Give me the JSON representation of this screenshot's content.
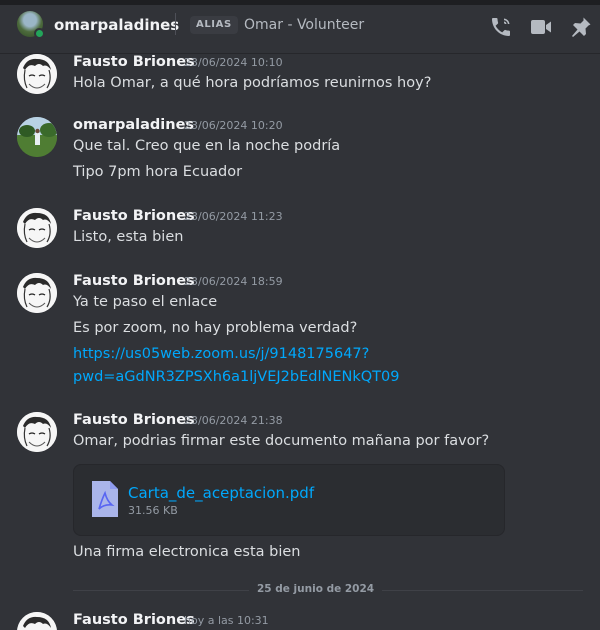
{
  "header": {
    "username": "omarpaladines",
    "alias_tag": "ALIAS",
    "alias_value": "Omar - Volunteer",
    "status_color": "#23a55a",
    "icons": [
      "voice-call-icon",
      "video-call-icon",
      "pin-icon"
    ]
  },
  "messages": [
    {
      "author": "Fausto Briones",
      "timestamp": "23/06/2024 10:10",
      "lines": [
        "Hola Omar, a qué hora podríamos reunirnos hoy?"
      ]
    },
    {
      "author": "omarpaladines",
      "timestamp": "23/06/2024 10:20",
      "lines": [
        "Que tal. Creo que en la noche podría",
        "Tipo 7pm hora Ecuador"
      ]
    },
    {
      "author": "Fausto Briones",
      "timestamp": "23/06/2024 11:23",
      "lines": [
        "Listo, esta bien"
      ]
    },
    {
      "author": "Fausto Briones",
      "timestamp": "23/06/2024 18:59",
      "lines": [
        "Ya te paso el enlace",
        "Es por zoom, no hay problema verdad?"
      ],
      "link_lines": [
        "https://us05web.zoom.us/j/9148175647?",
        "pwd=aGdNR3ZPSXh6a1ljVEJ2bEdlNENkQT09"
      ]
    },
    {
      "author": "Fausto Briones",
      "timestamp": "23/06/2024 21:38",
      "lines": [
        "Omar, podrias firmar este documento mañana por favor?",
        "Una firma electronica esta bien"
      ],
      "attachment": {
        "name": "Carta_de_aceptacion.pdf",
        "size": "31.56 KB"
      }
    },
    {
      "author": "Fausto Briones",
      "timestamp": "hoy a las 10:31",
      "lines": []
    }
  ],
  "date_divider": "25 de junio de 2024",
  "colors": {
    "background": "#313338",
    "link": "#00a8fc",
    "text": "#dbdee1",
    "muted": "#949ba4"
  }
}
